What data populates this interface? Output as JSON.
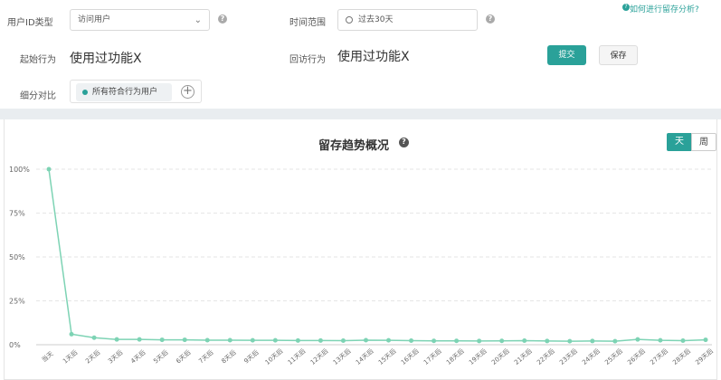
{
  "help_link": "如何进行留存分析?",
  "form": {
    "user_id_type": {
      "label": "用户ID类型",
      "value": "访问用户"
    },
    "time_range": {
      "label": "时间范围",
      "value": "过去30天"
    },
    "start_action": {
      "label": "起始行为",
      "value": "使用过功能X"
    },
    "return_action": {
      "label": "回访行为",
      "value": "使用过功能X"
    },
    "segment": {
      "label": "细分对比",
      "tag": "所有符合行为用户"
    },
    "submit_label": "提交",
    "save_label": "保存"
  },
  "chart_panel": {
    "title": "留存趋势概况",
    "toggle_day": "天",
    "toggle_week": "周"
  },
  "colors": {
    "accent": "#2aa199",
    "line": "#7dd3b4"
  },
  "chart_data": {
    "type": "line",
    "categories": [
      "当天",
      "1天后",
      "2天后",
      "3天后",
      "4天后",
      "5天后",
      "6天后",
      "7天后",
      "8天后",
      "9天后",
      "10天后",
      "11天后",
      "12天后",
      "13天后",
      "14天后",
      "15天后",
      "16天后",
      "17天后",
      "18天后",
      "19天后",
      "20天后",
      "21天后",
      "22天后",
      "23天后",
      "24天后",
      "25天后",
      "26天后",
      "27天后",
      "28天后",
      "29天后"
    ],
    "series": [
      {
        "values": [
          100,
          6,
          4,
          3,
          3,
          2.8,
          2.8,
          2.6,
          2.6,
          2.5,
          2.5,
          2.4,
          2.4,
          2.3,
          2.6,
          2.5,
          2.3,
          2.2,
          2.2,
          2.1,
          2.2,
          2.3,
          2.1,
          2.0,
          2.1,
          2.0,
          3.0,
          2.5,
          2.3,
          2.8
        ]
      }
    ],
    "yticks": [
      "0%",
      "25%",
      "50%",
      "75%",
      "100%"
    ],
    "ylim": [
      0,
      100
    ],
    "grid": true
  }
}
